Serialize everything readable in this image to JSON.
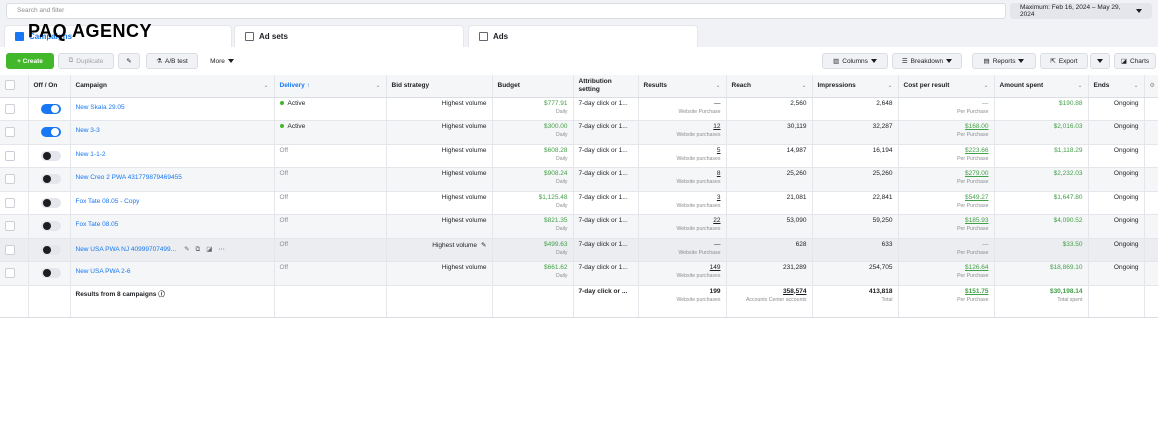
{
  "search": {
    "placeholder": "Search and filter"
  },
  "date_range": {
    "label": "Maximum: Feb 16, 2024 – May 29, 2024"
  },
  "watermark": "PAQ AGENCY",
  "tabs": [
    {
      "label": "Campaigns"
    },
    {
      "label": "Ad sets"
    },
    {
      "label": "Ads"
    }
  ],
  "toolbar": {
    "create": "+ Create",
    "duplicate": "Duplicate",
    "ab_test": "A/B test",
    "more": "More",
    "columns": "Columns",
    "breakdown": "Breakdown",
    "reports": "Reports",
    "export": "Export",
    "charts": "Charts"
  },
  "headers": {
    "off_on": "Off / On",
    "campaign": "Campaign",
    "delivery": "Delivery ↑",
    "bid_strategy": "Bid strategy",
    "budget": "Budget",
    "attribution": "Attribution setting",
    "results": "Results",
    "reach": "Reach",
    "impressions": "Impressions",
    "cost": "Cost per result",
    "spent": "Amount spent",
    "ends": "Ends"
  },
  "rows": [
    {
      "name": "New Skala 29.05",
      "delivery": "Active",
      "bid": "Highest volume",
      "budget": "$777.91",
      "budget_sub": "Daily",
      "attr": "7-day click or 1...",
      "results": "—",
      "results_sub": "Website Purchase",
      "reach": "2,560",
      "impr": "2,648",
      "cost": "—",
      "cost_sub": "Per Purchase",
      "spent": "$190.88",
      "ends": "Ongoing"
    },
    {
      "name": "New 3-3",
      "delivery": "Active",
      "bid": "Highest volume",
      "budget": "$300.00",
      "budget_sub": "Daily",
      "attr": "7-day click or 1...",
      "results": "12",
      "results_sub": "Website purchases",
      "reach": "30,119",
      "impr": "32,287",
      "cost": "$168.00",
      "cost_sub": "Per Purchase",
      "spent": "$2,016.03",
      "ends": "Ongoing"
    },
    {
      "name": "New 1-1-2",
      "delivery": "Off",
      "bid": "Highest volume",
      "budget": "$608.28",
      "budget_sub": "Daily",
      "attr": "7-day click or 1...",
      "results": "5",
      "results_sub": "Website purchases",
      "reach": "14,987",
      "impr": "16,194",
      "cost": "$223.66",
      "cost_sub": "Per Purchase",
      "spent": "$1,118.29",
      "ends": "Ongoing"
    },
    {
      "name": "New Creo 2 PWA 431779879469455",
      "delivery": "Off",
      "bid": "Highest volume",
      "budget": "$908.24",
      "budget_sub": "Daily",
      "attr": "7-day click or 1...",
      "results": "8",
      "results_sub": "Website purchases",
      "reach": "25,260",
      "impr": "25,260",
      "cost": "$279.00",
      "cost_sub": "Per Purchase",
      "spent": "$2,232.03",
      "ends": "Ongoing"
    },
    {
      "name": "Fox Tate 08.05 - Copy",
      "delivery": "Off",
      "bid": "Highest volume",
      "budget": "$1,125.48",
      "budget_sub": "Daily",
      "attr": "7-day click or 1...",
      "results": "3",
      "results_sub": "Website purchases",
      "reach": "21,081",
      "impr": "22,841",
      "cost": "$549.27",
      "cost_sub": "Per Purchase",
      "spent": "$1,647.80",
      "ends": "Ongoing"
    },
    {
      "name": "Fox Tate 08.05",
      "delivery": "Off",
      "bid": "Highest volume",
      "budget": "$821.35",
      "budget_sub": "Daily",
      "attr": "7-day click or 1...",
      "results": "22",
      "results_sub": "Website purchases",
      "reach": "53,090",
      "impr": "59,250",
      "cost": "$185.93",
      "cost_sub": "Per Purchase",
      "spent": "$4,090.52",
      "ends": "Ongoing"
    },
    {
      "name": "New USA PWA NJ 40999707499...",
      "delivery": "Off",
      "bid": "Highest volume",
      "budget": "$499.63",
      "budget_sub": "Daily",
      "attr": "7-day click or 1...",
      "results": "—",
      "results_sub": "Website Purchase",
      "reach": "628",
      "impr": "633",
      "cost": "—",
      "cost_sub": "Per Purchase",
      "spent": "$33.50",
      "ends": "Ongoing"
    },
    {
      "name": "New USA PWA 2-6",
      "delivery": "Off",
      "bid": "Highest volume",
      "budget": "$661.62",
      "budget_sub": "Daily",
      "attr": "7-day click or 1...",
      "results": "149",
      "results_sub": "Website purchases",
      "reach": "231,289",
      "impr": "254,705",
      "cost": "$126.64",
      "cost_sub": "Per Purchase",
      "spent": "$18,869.10",
      "ends": "Ongoing"
    }
  ],
  "totals": {
    "label": "Results from 8 campaigns",
    "attr": "7-day click or ...",
    "results": "199",
    "results_sub": "Website purchases",
    "reach": "358,574",
    "reach_sub": "Accounts Center accounts",
    "impr": "413,818",
    "impr_sub": "Total",
    "cost": "$151.75",
    "cost_sub": "Per Purchase",
    "spent": "$30,198.14",
    "spent_sub": "Total spent"
  }
}
